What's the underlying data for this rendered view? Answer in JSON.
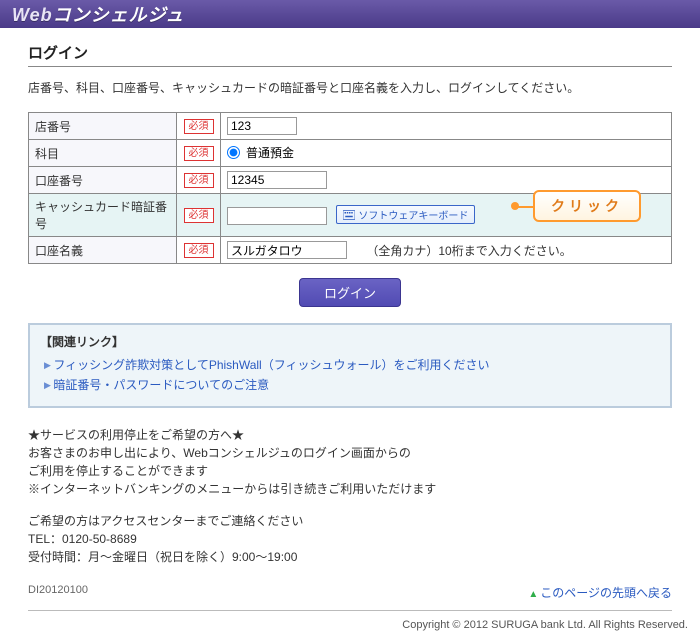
{
  "header": {
    "title_prefix": "Web",
    "title_rest": "コンシェルジュ"
  },
  "page": {
    "title": "ログイン",
    "intro": "店番号、科目、口座番号、キャッシュカードの暗証番号と口座名義を入力し、ログインしてください。"
  },
  "required_label": "必須",
  "fields": {
    "branch": {
      "label": "店番号",
      "value": "123"
    },
    "type": {
      "label": "科目",
      "option": "普通預金",
      "checked": true
    },
    "account": {
      "label": "口座番号",
      "value": "12345"
    },
    "pin": {
      "label": "キャッシュカード暗証番号",
      "value": "",
      "softkb": "ソフトウェアキーボード"
    },
    "name": {
      "label": "口座名義",
      "value": "スルガタロウ",
      "hint": "（全角カナ）10桁まで入力ください。"
    }
  },
  "login_button": "ログイン",
  "callout": "クリック",
  "links": {
    "title": "【関連リンク】",
    "items": [
      "フィッシング詐欺対策としてPhishWall（フィッシュウォール）をご利用ください",
      "暗証番号・パスワードについてのご注意"
    ]
  },
  "notice": {
    "line1": "★サービスの利用停止をご希望の方へ★",
    "line2": "お客さまのお申し出により、Webコンシェルジュのログイン画面からの",
    "line3": "ご利用を停止することができます",
    "line4": "※インターネットバンキングのメニューからは引き続きご利用いただけます",
    "line5": "ご希望の方はアクセスセンターまでご連絡ください",
    "line6": "TEL：0120-50-8689",
    "line7": "受付時間：月～金曜日（祝日を除く）9:00～19:00"
  },
  "page_id": "DI20120100",
  "back_top": "このページの先頭へ戻る",
  "copyright": "Copyright © 2012 SURUGA bank Ltd. All Rights Reserved."
}
